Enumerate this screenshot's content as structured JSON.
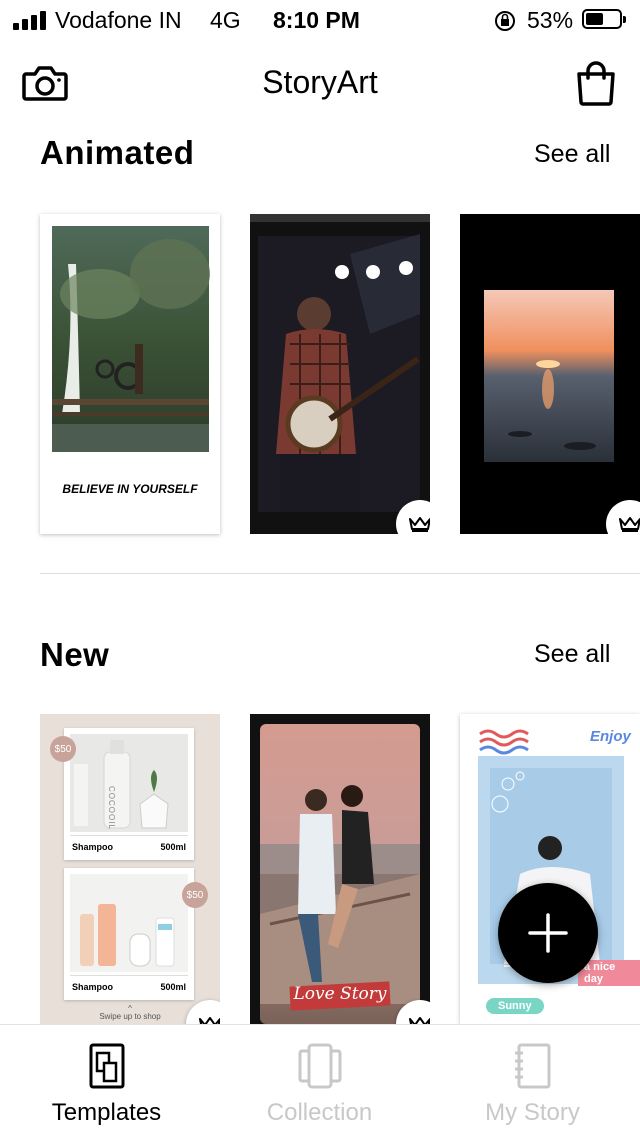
{
  "status_bar": {
    "carrier": "Vodafone IN",
    "network": "4G",
    "time": "8:10 PM",
    "battery_percent": "53%",
    "battery_level": 0.53
  },
  "header": {
    "title": "StoryArt",
    "left_icon": "camera-icon",
    "right_icon": "shopping-bag-icon"
  },
  "sections": [
    {
      "title": "Animated",
      "see_all": "See all",
      "cards": [
        {
          "caption": "BELIEVE IN YOURSELF",
          "premium": false
        },
        {
          "caption": "",
          "premium": true
        },
        {
          "caption": "",
          "premium": true
        }
      ]
    },
    {
      "title": "New",
      "see_all": "See all",
      "cards": [
        {
          "premium": true,
          "products": [
            {
              "name": "Shampoo",
              "size": "500ml",
              "price": "$50",
              "brand": "COCOOIL"
            },
            {
              "name": "Shampoo",
              "size": "500ml",
              "price": "$50"
            }
          ],
          "footer": "Swipe up to shop"
        },
        {
          "caption": "Love Story",
          "premium": true
        },
        {
          "caption_top": "Enjoy",
          "caption_mid": "a nice day",
          "caption_tag": "Sunny",
          "premium": false
        }
      ]
    }
  ],
  "fab": {
    "icon": "plus-icon"
  },
  "bottom_nav": [
    {
      "label": "Templates",
      "icon": "templates-icon",
      "active": true
    },
    {
      "label": "Collection",
      "icon": "collection-icon",
      "active": false
    },
    {
      "label": "My Story",
      "icon": "notebook-icon",
      "active": false
    }
  ],
  "colors": {
    "active": "#000000",
    "inactive": "#c8c8c8",
    "premium_badge": "#ffffff"
  }
}
